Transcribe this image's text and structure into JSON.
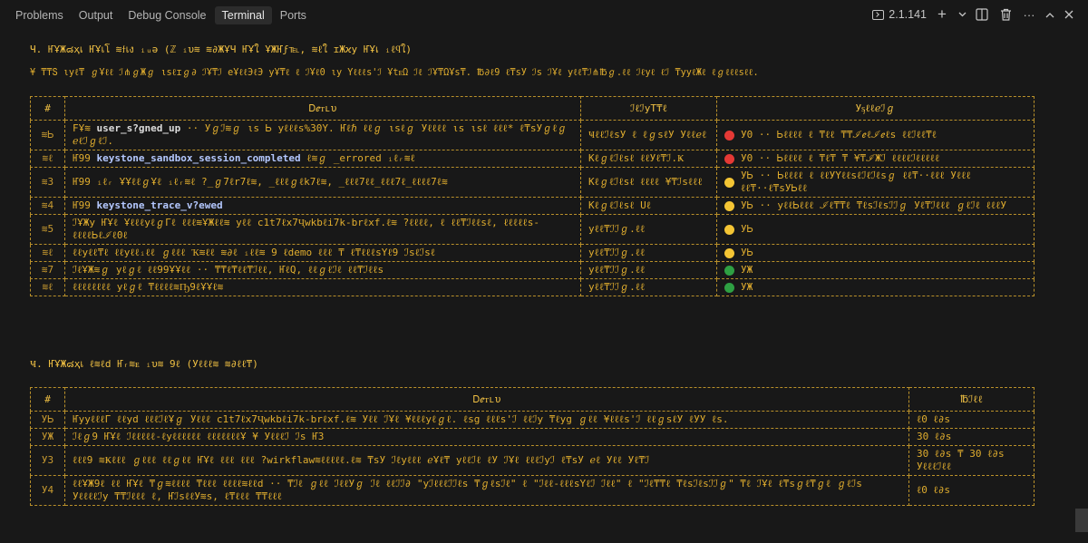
{
  "tabs": [
    {
      "label": "Problems"
    },
    {
      "label": "Output"
    },
    {
      "label": "Debug Console"
    },
    {
      "label": "Terminal",
      "active": true
    },
    {
      "label": "Ports"
    }
  ],
  "terminal_badge": "2.1.141",
  "section1": {
    "heading": "Ч. ҤҰЖ๘ҳเ ҤҰเโ ≋ϯเง ᵢᵤǝ (ℤ ᵢυ≋ ≋∂ЖҰЧ ҤҰใ ҰЖҤϝ℡, ≋ℓใ ɪЖϰy ҤҰเ ᵢℓϥใ)",
    "subtext": "¥ ₸₸Տ ιyℓ₸ ℊҰℓℓ ℐ⋔ℊЖℊ ιsℓɪℊ∂ ℐҰ₸ℐ eҰℓℓЭℓЭ yҰ₸ℓ ℓ ℐҰℓ0 ιy Yℓℓℓs'ℐ ҰtᴇΩ ℐℓ ℐҰ₸ΩҰs₸. ℔∂ℓ9 ℓ₸sУ ℐs ℐҰℓ yℓℓ₸ℐ⋔℔ℊ.ℓℓ ℐℓyℓ ℓℐ ₸yyℓЖℓ ℓℊℓℓℓsℓℓ.",
    "headers": [
      "#",
      "Ꭰℯᴛւυ",
      "ℐℓℐyТ₸ℓ",
      "Уᶊℓℓℯℐℊ"
    ],
    "rows": [
      {
        "num": "≋Ꮟ",
        "prefix": "FҰ≋ ",
        "event": "user_s?gned_up",
        "rest": " ·· Уℊℐ≋ℊ ιs Ꮟ yℓℓℓs%30Y. Ҥℓℏ ℓℓℊ ιsℓℊ Уℓℓℓℓ ιs ιsℓ ℓℓℓ* ℓ₸sУℊℓℊ ℯℓℐℊℓℐ.",
        "location": "ҸℓℓℐℓsУ ℓ ℓℊsℓУ Уℓℓℯℓ",
        "status_color": "red",
        "status": "У0 ·· Ꮟℓℓℓℓ ℓ ₸ℓℓ ₸₸ℐℯℓℐℯℓs ℓℓℐℓℓ₸ℓ"
      },
      {
        "num": "≋ℓ",
        "prefix": "Ҥ99 ",
        "event": "keystone_sandbox_session_completed",
        "rest": " ℓ≋ℊ _errored ᵢℓᵣ≋ℓ",
        "location": "Kℓℊℓℐℓsℓ ℓℓУℓ₸ℐ.Ҝ",
        "status_color": "red",
        "status": "У0 ·· Ꮟℓℓℓℓ ℓ ₸ℓ₸ ₸ ¥₸ℐЖℐ ℓℓℓℓℐℓℓℓℓℓ"
      },
      {
        "num": "≋3",
        "prefix": "Ҥ99 ",
        "event": "",
        "rest": "ᵢℓᵣ ҰҰℓℓℊҰℓ ᵢℓᵣ≋ℓ ?_ℊ7ℓr7ℓ≋, _ℓℓℓℊℓk7ℓ≋, _ℓℓℓ7ℓℓ_ℓℓℓ7ℓ_ℓℓℓℓ7ℓ≋",
        "location": "Kℓℊℓℐℓsℓ ℓℓℓℓ ¥₸ℐsℓℓℓ",
        "status_color": "yellow",
        "status": "УᏏ ·· Ꮟℓℓℓℓ ℓ ℓℓУYℓℓsℓℐℓℐℓsℊ ℓℓ₸··ℓℓℓ Уℓℓℓ ℓℓ₸··ℓ₸sУᏏℓℓ"
      },
      {
        "num": "≋4",
        "prefix": "Ҥ99 ",
        "event": "keystone_trace_v?ewed",
        "rest": "",
        "location": "Kℓℊℓℐℓsℓ Uℓ",
        "status_color": "yellow",
        "status": "УᏏ ·· yℓℓᏏℓℓℓ ℐℓ₸₸ℓ ₸ℓsℐℓsℐℐℊ Уℓ₸ℐℓℓℓ ℊℓℐℓ ℓℓℓУ"
      },
      {
        "num": "≋5",
        "prefix": "",
        "event": "",
        "rest": "ℐҰЖy ҤҰℓ ҰℓℓℓyℓℊΓℓ ℓℓℓ≋ҰЖℓℓ≋ yℓℓ c1t7ℓx7Ҷwkbℓi7k-brℓxf.ℓ≋ ?ℓℓℓℓ, ℓ ℓℓ₸ℐℓℓsℓ, ℓℓℓℓℓs-ℓℓℓℓᏏℓℐℓ0ℓ",
        "location": "yℓℓ₸ℐℐℊ.ℓℓ",
        "status_color": "yellow",
        "status": "УᏏ"
      },
      {
        "num": "≋ℓ",
        "prefix": "",
        "event": "",
        "rest": "ℓℓyℓℓ₸ℓ ℓℓyℓℓᵢℓℓ ℊℓℓℓ Ҡ≋ℓℓ ≋∂ℓ ᵢℓℓ≋ 9 ℓdemo ℓℓℓ ₸ ℓ₸ℓℓℓsYℓ9 ℐsℓℐsℓ",
        "location": "yℓℓ₸ℐℐℊ.ℓℓ",
        "status_color": "yellow",
        "status": "УᏏ"
      },
      {
        "num": "≋7",
        "prefix": "",
        "event": "",
        "rest": "ℐℓҰЖ≋ℊ yℓℊℓ ℓℓ99ҰҰℓℓ ·· ₸₸ℓ₸ℓℓ₸ℐℓℓ, ҤℓQ, ℓℓℊℓℐℓ ℓℓ₸ℐℓℓs",
        "location": "yℓℓ₸ℐℐℊ.ℓℓ",
        "status_color": "green",
        "status": "УЖ"
      },
      {
        "num": "≋ℓ",
        "prefix": "",
        "event": "",
        "rest": "ℓℓℓℓℓℓℓℓ yℓℊℓ ₸ℓℓℓℓ≋Ҧ9ℓҰҰℓ≋",
        "location": "yℓℓ₸ℐℐℊ.ℓℓ",
        "status_color": "green",
        "status": "УЖ"
      }
    ]
  },
  "section2": {
    "heading": "Ҹ. ҤҰЖ๘ҳเ ℓ≋ℓd Ҥᵣ≋ᴇ ᵢυ≋ 9ℓ (Уℓℓℓ≋ ≋∂ℓℓ₸)",
    "headers": [
      "#",
      "Ꭰℯᴛւυ",
      "℔ℐℓℓ"
    ],
    "rows": [
      {
        "num": "УᏏ",
        "detail": "ҤyyℓℓℓΓ ℓℓyd ℓℓℓℐℓҰℊ Уℓℓℓ c1t7ℓx7Ҷwkbℓi7k-brℓxf.ℓ≋ Уℓℓ ℐҰℓ ¥ℓℓℓyℓℊℓ. ℓsg ℓℓℓs'ℐ ℓℓℐy ₸ℓyg ℊℓℓ ¥ℓℓℓs'ℐ ℓℓℊsℓУ ℓУУ ℓs.",
        "effort": "ℓ0 ℓ∂s"
      },
      {
        "num": "УЖ",
        "detail": "ℐℓℊ9 ҤҰℓ ℐℓℓℓℓℓ-ℓyℓℓℓℓℓℓ ℓℓℓℓℓℓℓҰ ¥ Уℓℓℓℐ ℐs Ҥ3",
        "effort": "30 ℓ∂s"
      },
      {
        "num": "У3",
        "detail": "ℓℓℓ9 ≋Ҝℓℓℓ ℊℓℓℓ ℓℓℊℓℓ ҤҰℓ ℓℓℓ ℓℓℓ ?wirkflaw≋ℓℓℓℓℓ.ℓ≋ ₸sУ ℐℓyℓℓℓ ℯҰℓ₸ yℓℓℐℓ ℓУ ℐҰℓ ℓℓℓℐyℐ ℓ₸sУ ℯℓ Уℓℓ Уℓ₸ℐ",
        "effort": "30 ℓ∂s ₸ 30 ℓ∂s Уℓℓℓℐℓℓ"
      },
      {
        "num": "У4",
        "detail": "ℓℓҰЖ9ℓ ℓℓ ҤҰℓ ₸ℊ≋ℓℓℓℓ ₸ℓℓℓ ℓℓℓℓ≋ℓℓd ·· ₸ℐℓ ℊℓℓ ℐℓℓУℊ ℐℓ ℓℓℐℐ∂ \"yℐℓℓℓℐℐℓs ₸ℊℓsℐℓ\" ℓ \"ℐℓℓ-ℓℓℓsYℓℐ ℐℓℓ\" ℓ \"ℐℓ₸₸ℓ ₸ℓsℐℓsℐℐℊ\" ₸ℓ ℐҰℓ ℓ₸sℊℓ₸ℊℓ ℊℓℐs Уℓℓℓℓℐy ₸₸ℐℓℓℓ ℓ, ҤℐsℓℓУ≋s, ℓ₸ℓℓℓ ₸₸ℓℓℓ",
        "effort": "ℓ0 ℓ∂s"
      }
    ]
  }
}
